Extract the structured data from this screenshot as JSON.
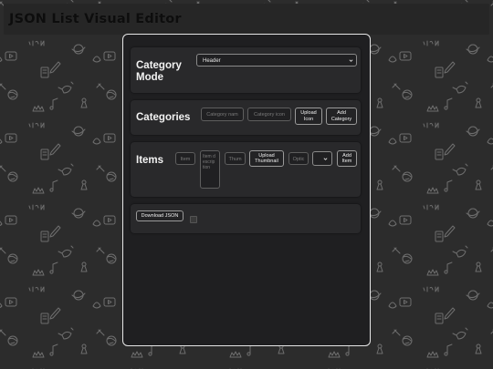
{
  "app": {
    "title": "JSON List Visual Editor"
  },
  "category_mode": {
    "label_line1": "Category",
    "label_line2": "Mode",
    "selected": "Header"
  },
  "categories": {
    "label": "Categories",
    "name_placeholder": "Category nam",
    "icon_placeholder": "Category icon",
    "upload_icon_line1": "Upload",
    "upload_icon_line2": "Icon",
    "add_category_line1": "Add",
    "add_category_line2": "Category"
  },
  "items": {
    "label": "Items",
    "name_placeholder": "Item",
    "description_placeholder": "Item description",
    "thumbnail_placeholder": "Thum",
    "upload_thumbnail_line1": "Upload",
    "upload_thumbnail_line2": "Thumbnail",
    "option_placeholder": "Optic",
    "add_item_line1": "Add",
    "add_item_line2": "Item"
  },
  "download": {
    "button_label": "Download JSON"
  },
  "background": {
    "doodle_color": "#6e6e6e",
    "background_color": "#2c2c2c"
  }
}
